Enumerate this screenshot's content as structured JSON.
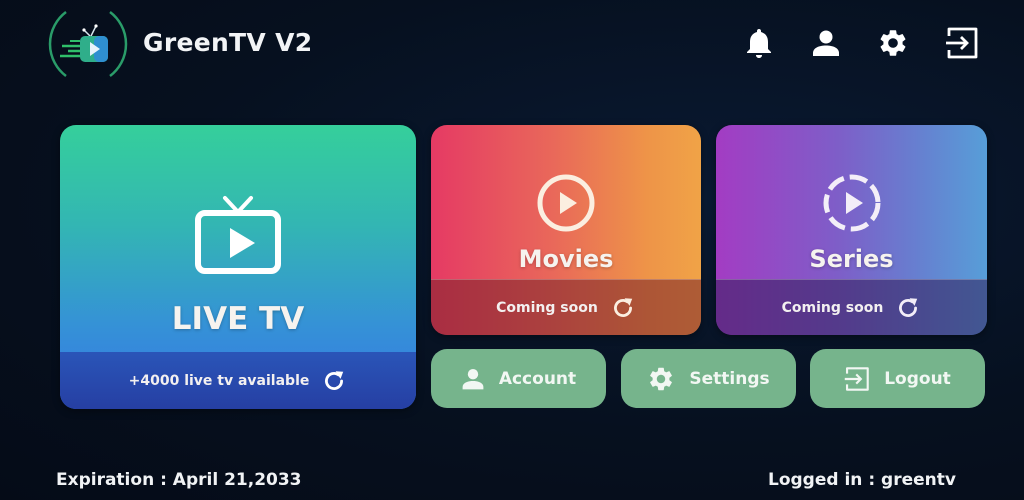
{
  "app": {
    "title": "GreenTV V2",
    "logo_icon": "tv-play-logo-icon"
  },
  "header_icons": [
    {
      "name": "notifications",
      "icon": "bell-icon"
    },
    {
      "name": "profile",
      "icon": "user-icon"
    },
    {
      "name": "settings",
      "icon": "gear-icon"
    },
    {
      "name": "logout",
      "icon": "logout-icon"
    }
  ],
  "cards": {
    "live_tv": {
      "title": "LIVE TV",
      "icon": "tv-play-icon",
      "footer": "+4000 live tv available",
      "footer_icon": "refresh-icon"
    },
    "movies": {
      "title": "Movies",
      "icon": "play-circle-icon",
      "footer": "Coming soon",
      "footer_icon": "refresh-icon"
    },
    "series": {
      "title": "Series",
      "icon": "play-circle-dashed-icon",
      "footer": "Coming soon",
      "footer_icon": "refresh-icon"
    }
  },
  "buttons": {
    "account": {
      "label": "Account",
      "icon": "user-icon"
    },
    "settings": {
      "label": "Settings",
      "icon": "gear-icon"
    },
    "logout": {
      "label": "Logout",
      "icon": "logout-icon"
    }
  },
  "footer": {
    "expiration": "Expiration : April 21,2033",
    "logged_in": "Logged in : greentv"
  },
  "colors": {
    "background": "#06101f",
    "live_tv_gradient": [
      "#35cf9b",
      "#3676e6"
    ],
    "movies_gradient": [
      "#e53a64",
      "#f0a347"
    ],
    "series_gradient": [
      "#a33cc3",
      "#579ed8"
    ],
    "action_button": "#76b48c",
    "logo_ring": "#1f8a5c"
  }
}
